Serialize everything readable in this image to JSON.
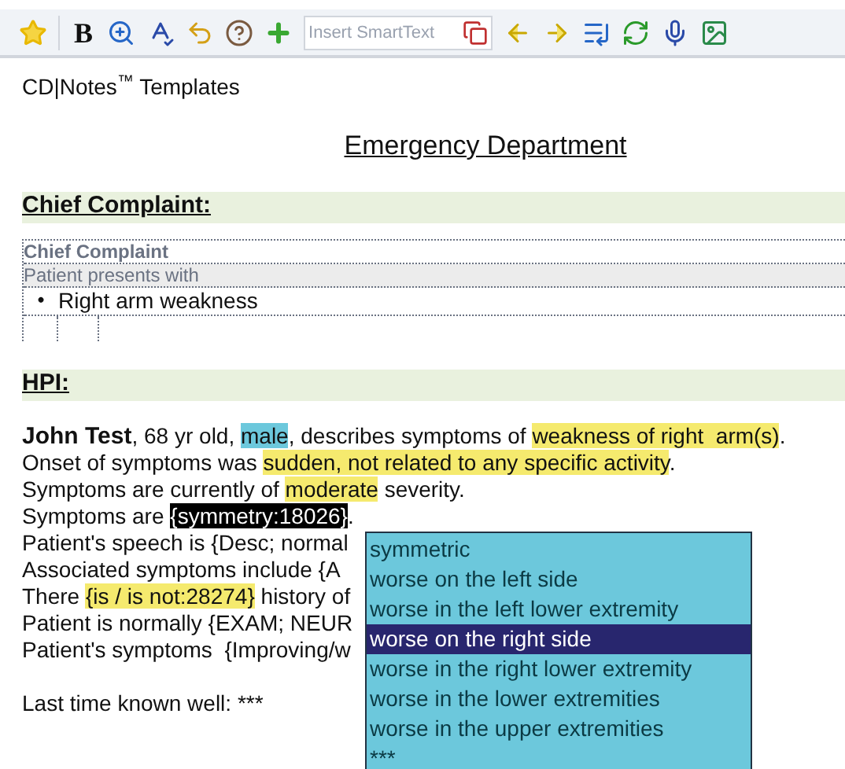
{
  "toolbar": {
    "bold_label": "B",
    "smarttext": {
      "placeholder": "Insert SmartText"
    }
  },
  "heading": "CD|Notes$^{™}$ Templates",
  "title": "Emergency Department",
  "sections": [
    {
      "title": "Chief Complaint:",
      "table": {
        "rows": [
          {
            "kind": "label",
            "text": "Chief Complaint"
          },
          {
            "kind": "shaded",
            "text": "Patient presents with"
          },
          {
            "kind": "bullet",
            "bullet": "•",
            "text": "Right arm weakness"
          },
          {
            "kind": "empty"
          }
        ]
      }
    },
    {
      "title": "HPI:"
    }
  ],
  "paragraphs": [
    [
      {
        "text": "John Test",
        "kind": "bold"
      },
      {
        "text": ", 68 yr old, ",
        "kind": "plain"
      },
      {
        "text": "male",
        "kind": "cyan"
      },
      {
        "text": ", describes symptoms of ",
        "kind": "plain"
      },
      {
        "text": "weakness of right  arm(s)",
        "kind": "yellow"
      },
      {
        "text": ".",
        "kind": "plain"
      }
    ],
    [
      {
        "text": "Onset of symptoms was ",
        "kind": "plain"
      },
      {
        "text": "sudden, not related to any specific activity",
        "kind": "yellow"
      },
      {
        "text": ".",
        "kind": "plain"
      }
    ],
    [
      {
        "text": "Symptoms are currently of ",
        "kind": "plain"
      },
      {
        "text": "moderate",
        "kind": "yellow"
      },
      {
        "text": " severity.",
        "kind": "plain"
      }
    ],
    [
      {
        "text": "Symptoms are ",
        "kind": "plain"
      },
      {
        "text": "{symmetry:18026}",
        "kind": "selected"
      },
      {
        "text": ".",
        "kind": "plain"
      }
    ],
    [
      {
        "text": "Patient's speech is {Desc; normal",
        "kind": "plain"
      }
    ],
    [
      {
        "text": "Associated symptoms include {A",
        "kind": "plain"
      }
    ],
    [
      {
        "text": "There ",
        "kind": "plain"
      },
      {
        "text": "{is / is not:28274}",
        "kind": "yellow"
      },
      {
        "text": " history of",
        "kind": "plain"
      }
    ],
    [
      {
        "text": "Patient is normally {EXAM; NEUR",
        "kind": "plain"
      }
    ],
    [
      {
        "text": "Patient's symptoms  {Improving/w",
        "kind": "plain"
      }
    ]
  ],
  "closing": "Last time known well: ***",
  "dropdown": {
    "options": [
      {
        "label": "symmetric",
        "selected": false
      },
      {
        "label": "worse on the left side",
        "selected": false
      },
      {
        "label": "worse in the left lower extremity",
        "selected": false
      },
      {
        "label": "worse on the right side",
        "selected": true
      },
      {
        "label": "worse in the right lower extremity",
        "selected": false
      },
      {
        "label": "worse in the lower extremities",
        "selected": false
      },
      {
        "label": "worse in the upper extremities",
        "selected": false
      },
      {
        "label": "***",
        "selected": false
      }
    ]
  }
}
